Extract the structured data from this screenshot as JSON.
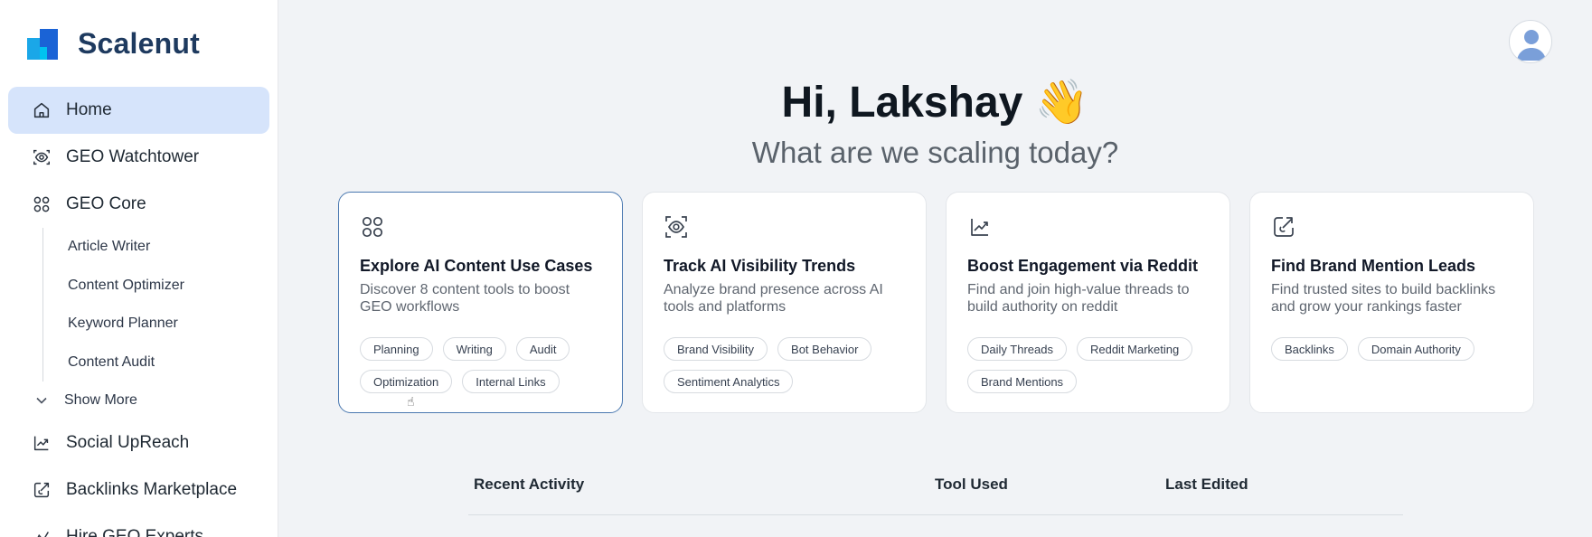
{
  "brand": {
    "name": "Scalenut"
  },
  "sidebar": {
    "items": [
      {
        "label": "Home",
        "icon": "home-icon"
      },
      {
        "label": "GEO Watchtower",
        "icon": "eye-scan-icon"
      },
      {
        "label": "GEO Core",
        "icon": "grid-circles-icon"
      }
    ],
    "sub_items": [
      {
        "label": "Article Writer"
      },
      {
        "label": "Content Optimizer"
      },
      {
        "label": "Keyword Planner"
      },
      {
        "label": "Content Audit"
      }
    ],
    "show_more": "Show More",
    "bottom_items": [
      {
        "label": "Social UpReach",
        "icon": "trend-chart-icon"
      },
      {
        "label": "Backlinks Marketplace",
        "icon": "link-edit-icon"
      },
      {
        "label": "Hire GEO Experts",
        "icon": "expert-icon"
      }
    ]
  },
  "hero": {
    "greeting": "Hi, Lakshay 👋",
    "subtitle": "What are we scaling today?"
  },
  "cards": [
    {
      "title": "Explore AI Content Use Cases",
      "desc": "Discover 8 content tools to boost GEO workflows",
      "icon": "grid-circles-icon",
      "tags": [
        "Planning",
        "Writing",
        "Audit",
        "Optimization",
        "Internal Links"
      ]
    },
    {
      "title": "Track AI Visibility Trends",
      "desc": "Analyze brand presence across AI tools and platforms",
      "icon": "eye-scan-icon",
      "tags": [
        "Brand Visibility",
        "Bot Behavior",
        "Sentiment Analytics"
      ]
    },
    {
      "title": "Boost Engagement via Reddit",
      "desc": "Find and join high-value threads to build authority on reddit",
      "icon": "trend-chart-icon",
      "tags": [
        "Daily Threads",
        "Reddit Marketing",
        "Brand Mentions"
      ]
    },
    {
      "title": "Find Brand Mention Leads",
      "desc": "Find trusted sites to build backlinks and grow your rankings faster",
      "icon": "link-edit-icon",
      "tags": [
        "Backlinks",
        "Domain Authority"
      ]
    }
  ],
  "recent": {
    "col_activity": "Recent Activity",
    "col_tool": "Tool Used",
    "col_edited": "Last Edited"
  },
  "colors": {
    "active_nav": "#d6e4fb",
    "brand_blue": "#1a63d6",
    "card_hover_border": "#4a78b0"
  }
}
